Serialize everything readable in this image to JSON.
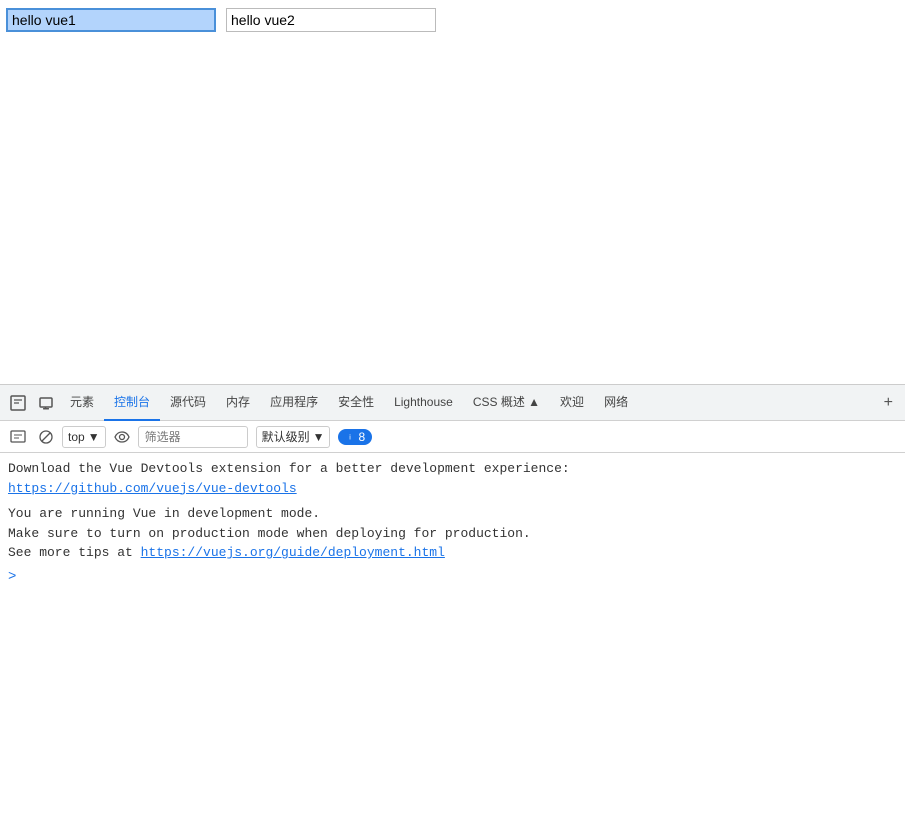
{
  "page": {
    "input1_value": "hello vue1",
    "input2_value": "hello vue2"
  },
  "devtools": {
    "tabs": [
      {
        "id": "inspect",
        "label": "🔍",
        "icon": true,
        "active": false
      },
      {
        "id": "device",
        "label": "⬜",
        "icon": true,
        "active": false
      },
      {
        "id": "elements",
        "label": "元素",
        "active": false
      },
      {
        "id": "console",
        "label": "控制台",
        "active": true
      },
      {
        "id": "source",
        "label": "源代码",
        "active": false
      },
      {
        "id": "memory",
        "label": "内存",
        "active": false
      },
      {
        "id": "application",
        "label": "应用程序",
        "active": false
      },
      {
        "id": "security",
        "label": "安全性",
        "active": false
      },
      {
        "id": "lighthouse",
        "label": "Lighthouse",
        "active": false
      },
      {
        "id": "css-overview",
        "label": "CSS 概述 ▲",
        "active": false
      },
      {
        "id": "welcome",
        "label": "欢迎",
        "active": false
      },
      {
        "id": "network",
        "label": "网络",
        "active": false
      }
    ],
    "toolbar": {
      "clear_label": "🚫",
      "context": "top",
      "filter_placeholder": "筛选器",
      "level": "默认级别",
      "message_count": "8"
    },
    "console_messages": [
      {
        "id": 1,
        "text": "Download the Vue Devtools extension for a better development experience:",
        "link": "https://github.com/vuejs/vue-devtools",
        "link_text": "https://github.com/vuejs/vue-devtools"
      },
      {
        "id": 2,
        "text": "You are running Vue in development mode.",
        "sub1": "Make sure to turn on production mode when deploying for production.",
        "sub2_prefix": "See more tips at ",
        "sub2_link": "https://vuejs.org/guide/deployment.html",
        "sub2_link_text": "https://vuejs.org/guide/deployment.html"
      }
    ]
  }
}
